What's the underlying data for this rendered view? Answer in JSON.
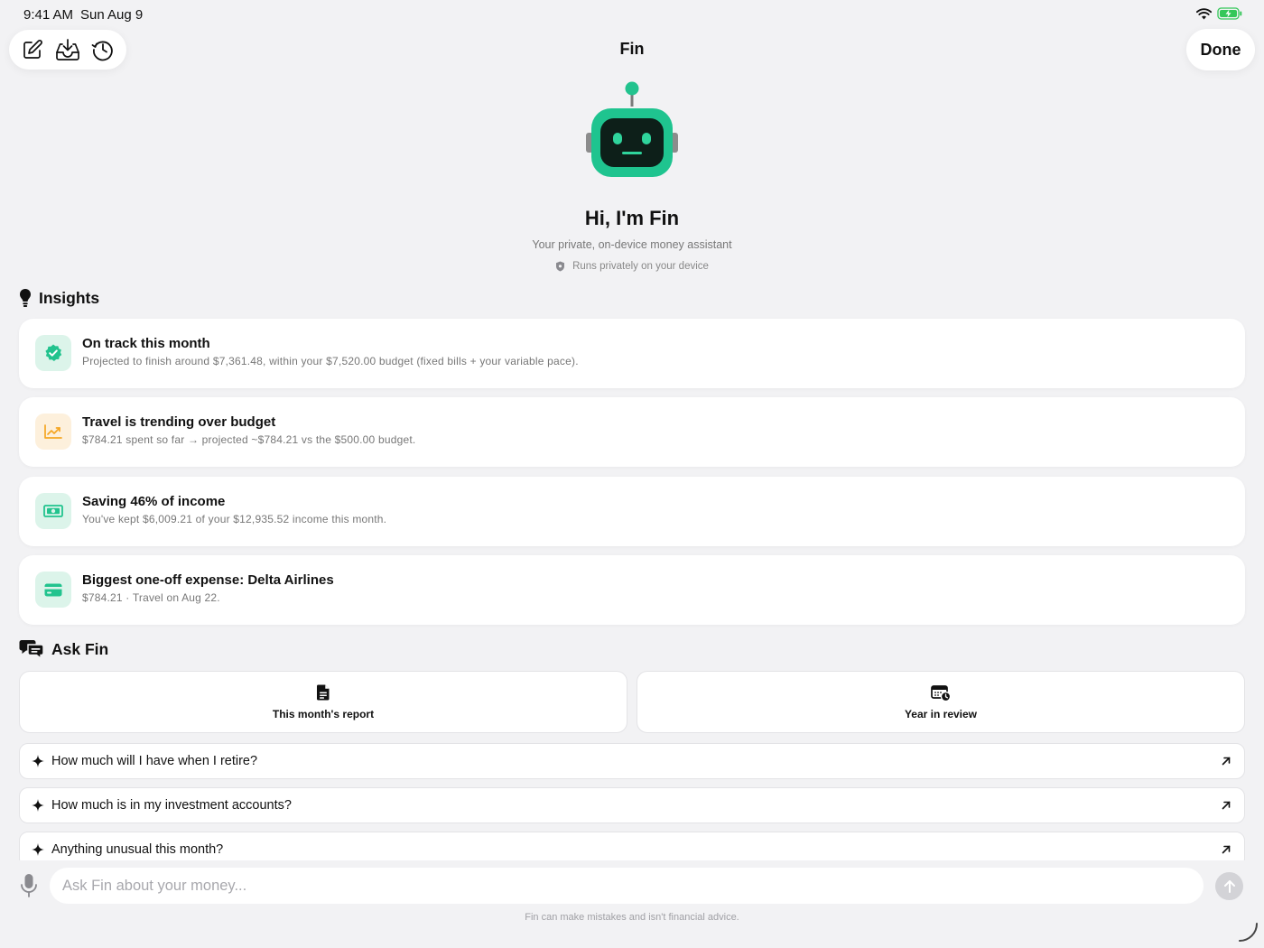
{
  "status_bar": {
    "time": "9:41 AM",
    "date": "Sun Aug 9"
  },
  "nav": {
    "title": "Fin",
    "done_label": "Done"
  },
  "hero": {
    "title": "Hi, I'm Fin",
    "subtitle": "Your private, on-device money assistant",
    "privacy_note": "Runs privately on your device"
  },
  "insights": {
    "heading": "Insights",
    "items": [
      {
        "icon": "checkmark-seal-icon",
        "title": "On track this month",
        "description": "Projected to finish around $7,361.48, within your $7,520.00 budget (fixed bills + your variable pace)."
      },
      {
        "icon": "trending-chart-icon",
        "title": "Travel is trending over budget",
        "description": "$784.21 spent so far → projected ~$784.21 vs the $500.00 budget."
      },
      {
        "icon": "banknote-icon",
        "title": "Saving 46% of income",
        "description": "You've kept $6,009.21 of your $12,935.52 income this month."
      },
      {
        "icon": "credit-card-icon",
        "title": "Biggest one-off expense: Delta Airlines",
        "description": "$784.21 · Travel on Aug 22."
      }
    ]
  },
  "ask": {
    "heading": "Ask Fin",
    "tiles": [
      {
        "icon": "document-icon",
        "label": "This month's report"
      },
      {
        "icon": "calendar-clock-icon",
        "label": "Year in review"
      }
    ],
    "questions": [
      "How much will I have when I retire?",
      "How much is in my investment accounts?",
      "Anything unusual this month?"
    ]
  },
  "input": {
    "placeholder": "Ask Fin about your money..."
  },
  "disclaimer": "Fin can make mistakes and isn't financial advice.",
  "colors": {
    "accent": "#22c38e",
    "warning": "#f5a623",
    "background": "#f2f2f4"
  }
}
